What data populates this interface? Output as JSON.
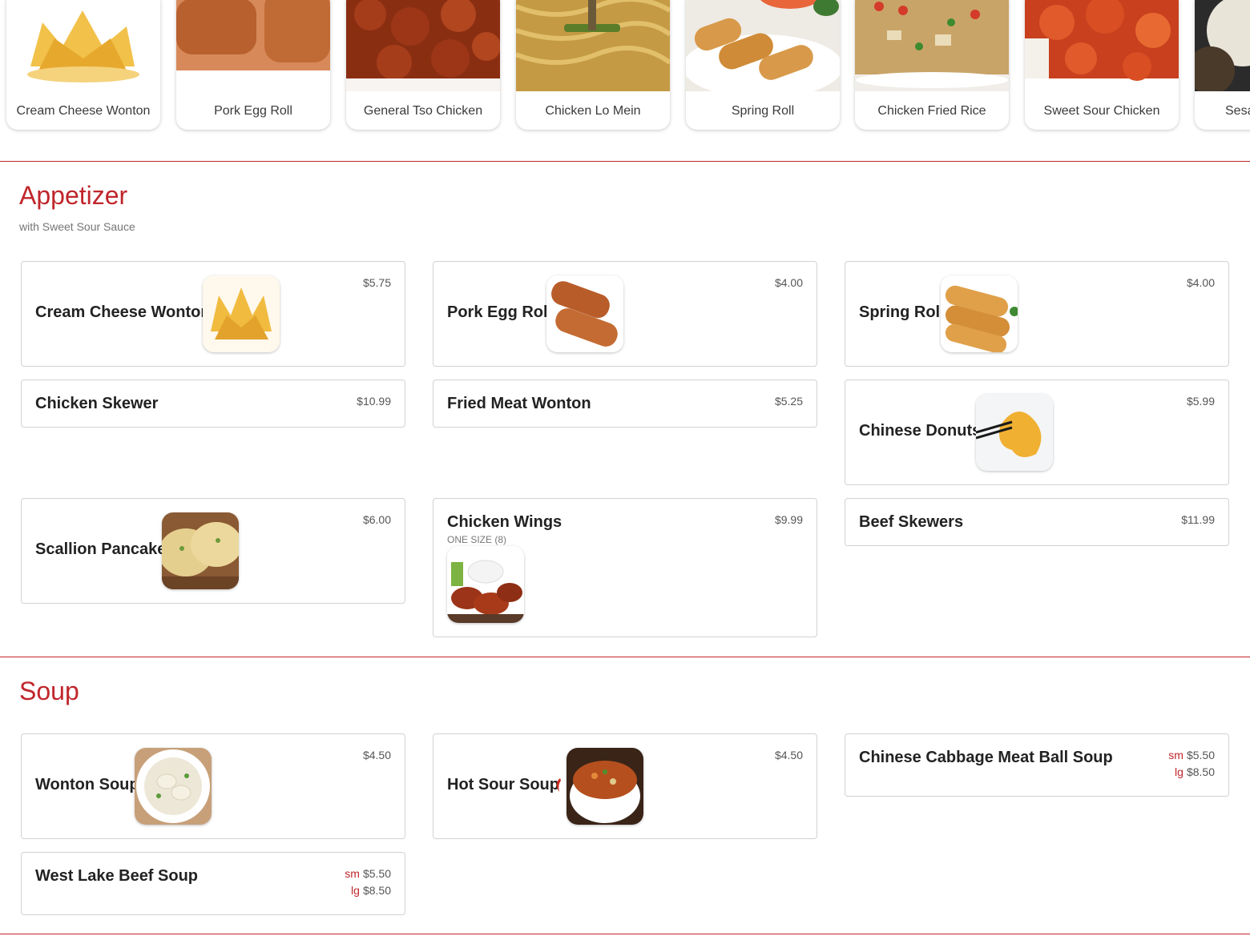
{
  "carousel": {
    "items": [
      {
        "label": "Cream Cheese Wonton"
      },
      {
        "label": "Pork Egg Roll"
      },
      {
        "label": "General Tso Chicken"
      },
      {
        "label": "Chicken Lo Mein"
      },
      {
        "label": "Spring Roll"
      },
      {
        "label": "Chicken Fried Rice"
      },
      {
        "label": "Sweet Sour Chicken"
      },
      {
        "label": "Sesa"
      }
    ]
  },
  "appetizer": {
    "title": "Appetizer",
    "subtitle": "with Sweet Sour Sauce",
    "items": [
      {
        "name": "Cream Cheese Wonton",
        "price": "$5.75"
      },
      {
        "name": "Pork Egg Roll",
        "price": "$4.00"
      },
      {
        "name": "Spring Roll",
        "price": "$4.00"
      },
      {
        "name": "Chicken Skewer",
        "price": "$10.99"
      },
      {
        "name": "Fried Meat Wonton",
        "price": "$5.25"
      },
      {
        "name": "Chinese Donuts",
        "price": "$5.99"
      },
      {
        "name": "Scallion Pancake",
        "price": "$6.00"
      },
      {
        "name": "Chicken Wings",
        "price": "$9.99",
        "note": "ONE SIZE (8)"
      },
      {
        "name": "Beef Skewers",
        "price": "$11.99"
      }
    ]
  },
  "soup": {
    "title": "Soup",
    "items": [
      {
        "name": "Wonton Soup",
        "price": "$4.50"
      },
      {
        "name": "Hot Sour Soup",
        "price": "$4.50"
      },
      {
        "name": "Chinese Cabbage Meat Ball Soup",
        "sizes": [
          {
            "size": "sm",
            "price": "$5.50"
          },
          {
            "size": "lg",
            "price": "$8.50"
          }
        ]
      },
      {
        "name": "West Lake Beef Soup",
        "sizes": [
          {
            "size": "sm",
            "price": "$5.50"
          },
          {
            "size": "lg",
            "price": "$8.50"
          }
        ]
      }
    ]
  },
  "colors": {
    "accent": "#c0262c",
    "border": "#d2d2d2",
    "text": "#222222"
  },
  "icons": {
    "spicy": "chili-pepper-icon"
  }
}
